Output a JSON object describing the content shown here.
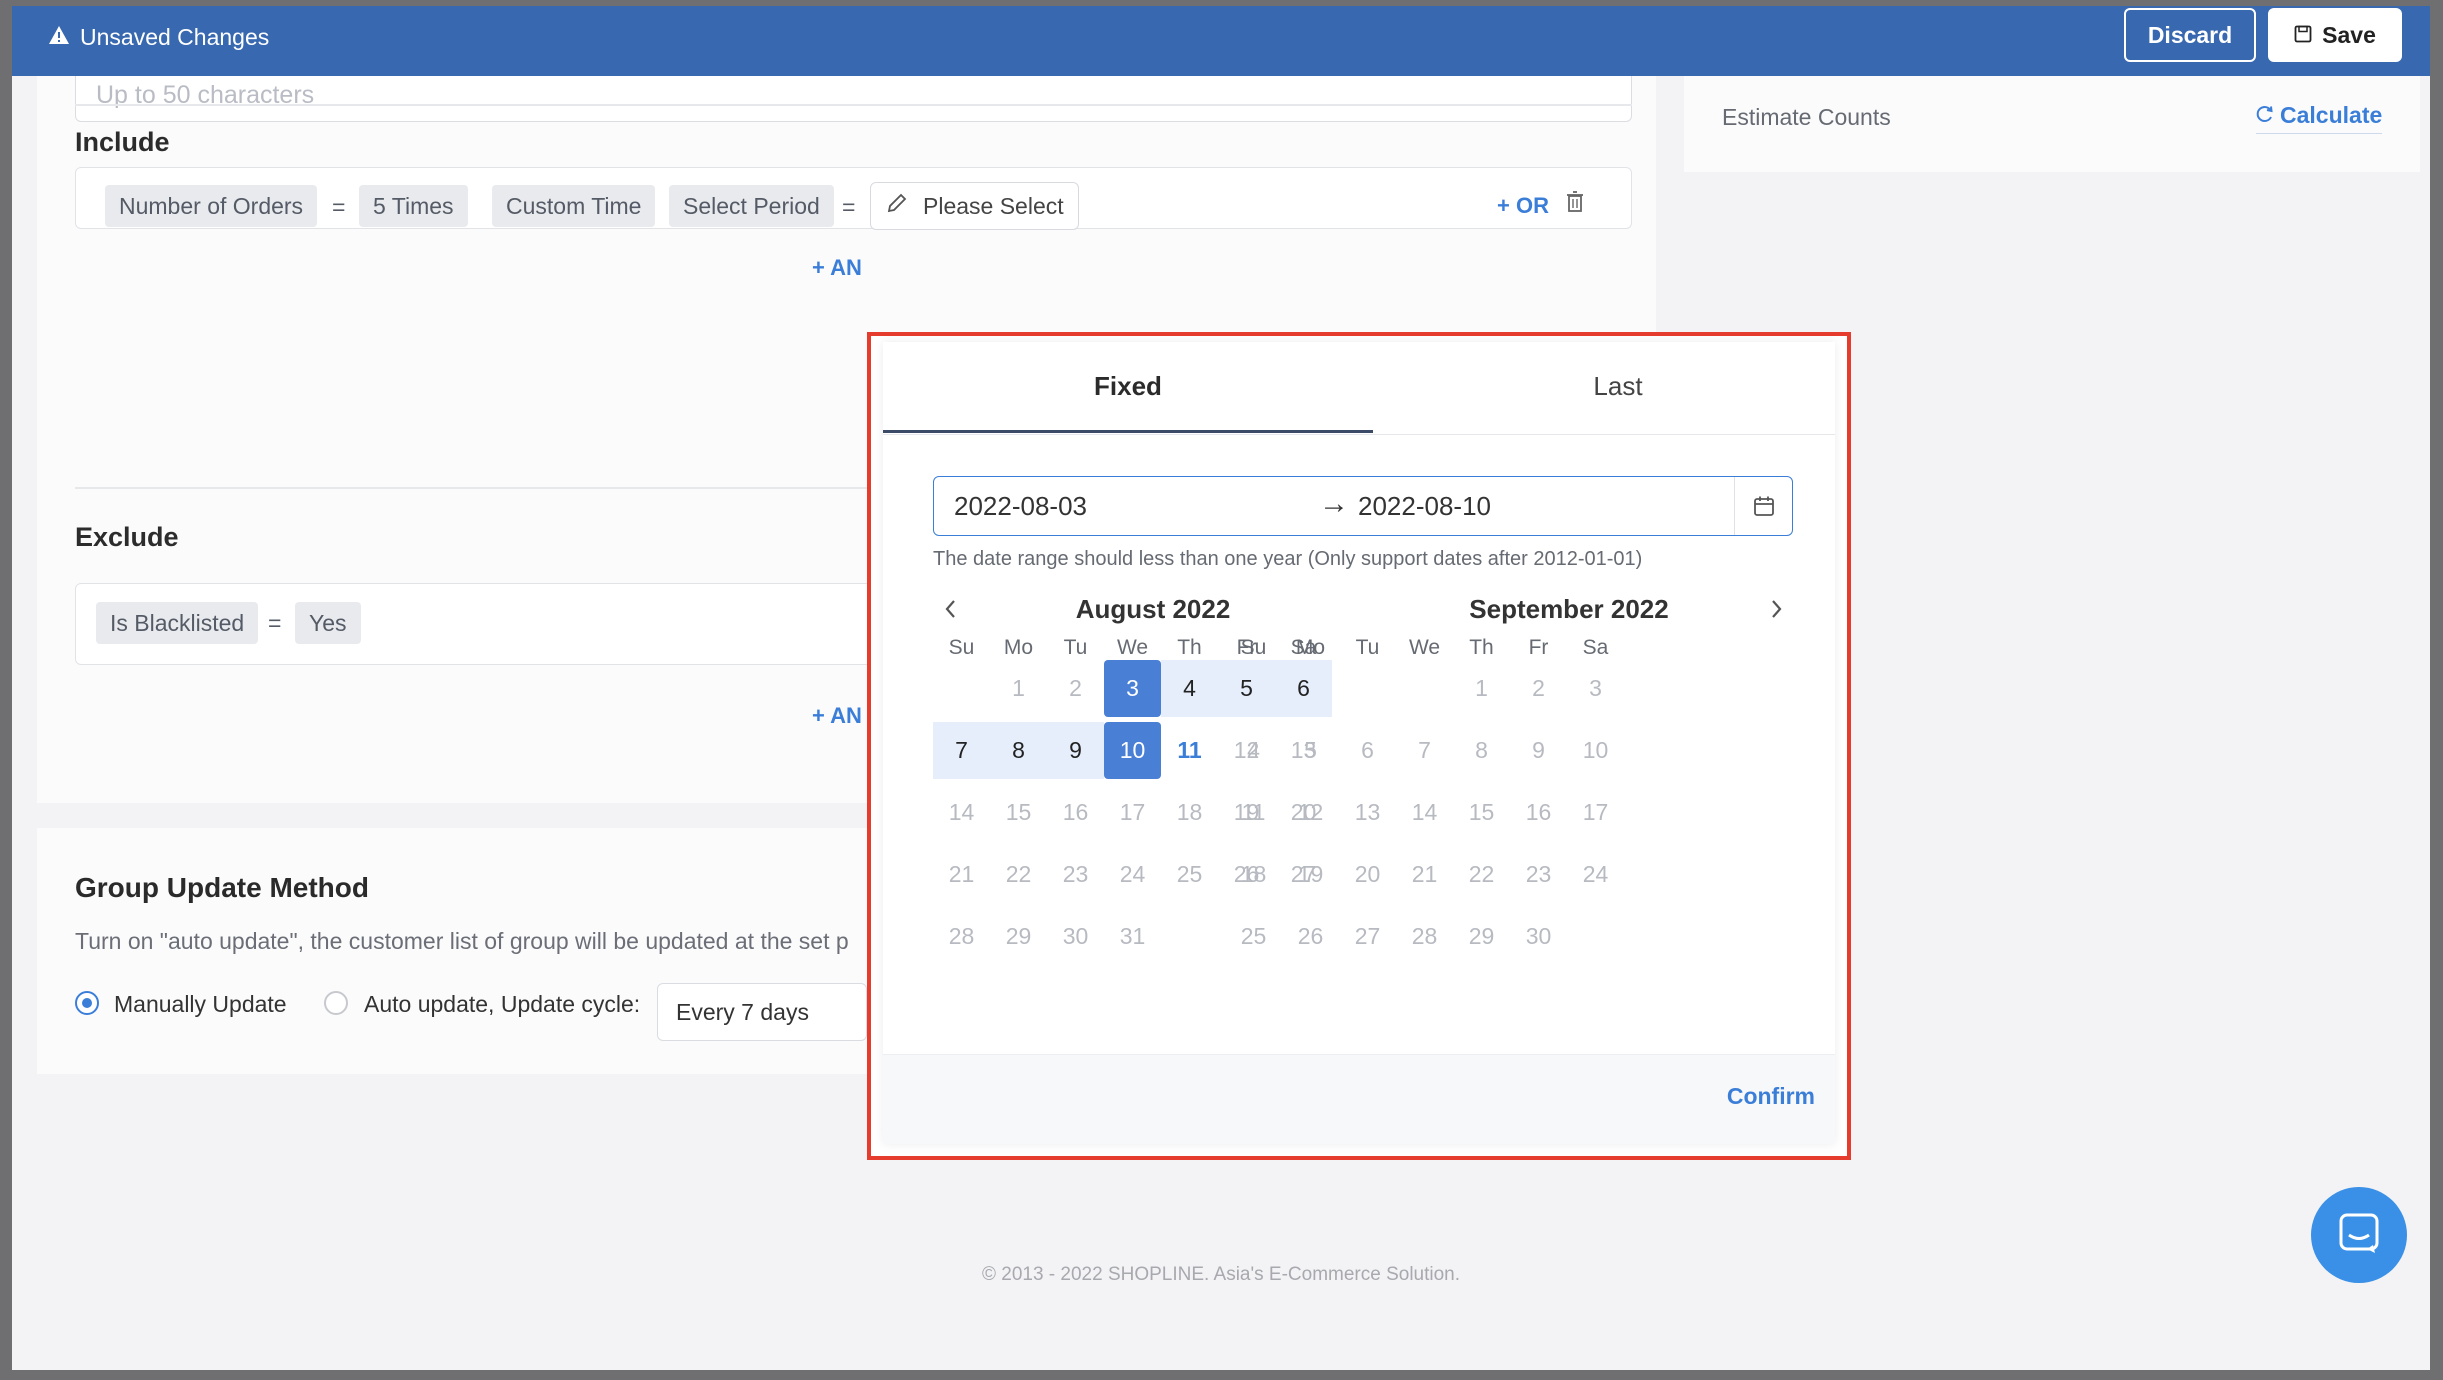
{
  "topbar": {
    "warning": "Unsaved Changes",
    "discard": "Discard",
    "save": "Save"
  },
  "form": {
    "name_placeholder": "Up to 50 characters",
    "include_title": "Include",
    "include_rule": {
      "field": "Number of Orders",
      "eq1": "=",
      "value": "5 Times",
      "time": "Custom Time",
      "period": "Select Period",
      "eq2": "=",
      "please": "Please Select",
      "or": "+ OR"
    },
    "add_and": "+ AN",
    "exclude_title": "Exclude",
    "exclude_rule": {
      "field": "Is Blacklisted",
      "eq": "=",
      "value": "Yes"
    }
  },
  "group_update": {
    "title": "Group Update Method",
    "desc": "Turn on \"auto update\", the customer list of group will be updated at the set p",
    "manual": "Manually Update",
    "auto": "Auto update, Update cycle:",
    "cycle": "Every 7 days",
    "manual_selected": true
  },
  "estimate": {
    "label": "Estimate Counts",
    "calculate": "Calculate"
  },
  "footer": "© 2013 - 2022 SHOPLINE. Asia's E-Commerce Solution.",
  "datepicker": {
    "tabs": [
      "Fixed",
      "Last"
    ],
    "active_tab": "Fixed",
    "start": "2022-08-03",
    "end": "2022-08-10",
    "hint": "The date range should less than one year (Only support dates after 2012-01-01)",
    "weekdays": [
      "Su",
      "Mo",
      "Tu",
      "We",
      "Th",
      "Fr",
      "Sa"
    ],
    "months": [
      {
        "title": "August 2022",
        "first_weekday": 1,
        "days": 31
      },
      {
        "title": "September 2022",
        "first_weekday": 4,
        "days": 30
      }
    ],
    "range_start_day": 3,
    "range_end_day": 10,
    "today": 11,
    "confirm": "Confirm"
  },
  "colors": {
    "topbar": "#3869b0",
    "accent": "#3b7ed8",
    "highlight_border": "#e63c2e",
    "selected": "#4a7fd6",
    "range": "#e6eefb"
  }
}
